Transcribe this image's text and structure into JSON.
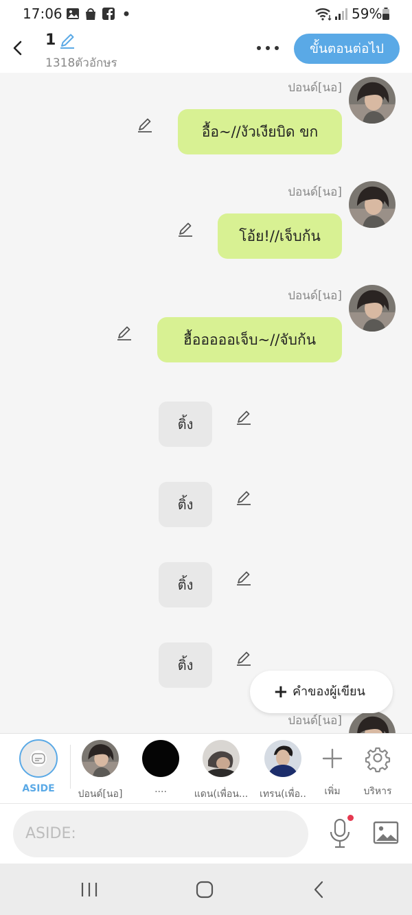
{
  "status_bar": {
    "time": "17:06",
    "battery": "59%"
  },
  "header": {
    "episode_number": "1",
    "char_count": "1318ตัวอักษร",
    "next_button": "ขั้นตอนต่อไป"
  },
  "messages": [
    {
      "speaker": "ปอนด์[นอ]",
      "text": "อื้อ~//งัวเงียบิด ขก"
    },
    {
      "speaker": "ปอนด์[นอ]",
      "text": "โอ้ย!//เจ็บก้น"
    },
    {
      "speaker": "ปอนด์[นอ]",
      "text": "ฮื้อออออเจ็บ~//จับก้น"
    }
  ],
  "sound_effects": [
    "ติ้ง",
    "ติ้ง",
    "ติ้ง",
    "ติ้ง"
  ],
  "partial_speaker": "ปอนด์[นอ]",
  "writer_button": "คำของผู้เขียน",
  "characters": [
    {
      "name": "ASIDE"
    },
    {
      "name": "ปอนด์[นอ]"
    },
    {
      "name": "...."
    },
    {
      "name": "แดน(เพื่อน..."
    },
    {
      "name": "เทรน(เพื่อ.."
    }
  ],
  "char_actions": {
    "add": "เพิ่ม",
    "manage": "บริหาร"
  },
  "input": {
    "placeholder": "ASIDE:"
  },
  "colors": {
    "accent": "#5aa9e6",
    "bubble": "#d8f193",
    "sfx_bg": "#e8e8e8",
    "notification_dot": "#e53950"
  }
}
